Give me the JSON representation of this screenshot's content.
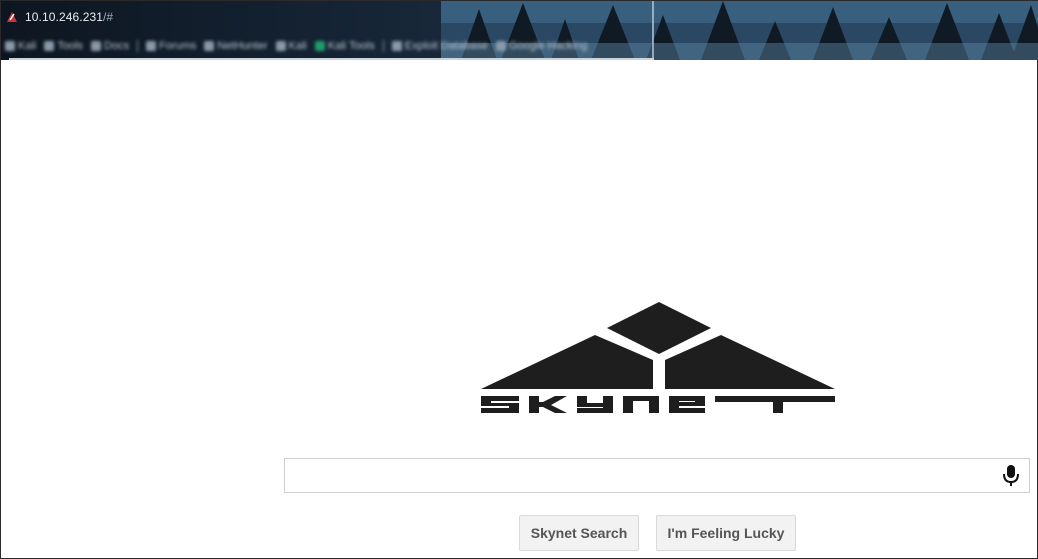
{
  "browser": {
    "url_host": "10.10.246.231",
    "url_hash": "/#"
  },
  "search": {
    "value": "",
    "placeholder": ""
  },
  "buttons": {
    "search_label": "Skynet Search",
    "lucky_label": "I'm Feeling Lucky"
  },
  "logo": {
    "name": "SKYNET",
    "color": "#1e1e1e"
  },
  "icons": {
    "site": "fox-icon",
    "mic": "microphone-icon"
  },
  "colors": {
    "button_bg": "#f2f2f2",
    "button_text": "#555555",
    "search_border": "#cfcfcf"
  }
}
